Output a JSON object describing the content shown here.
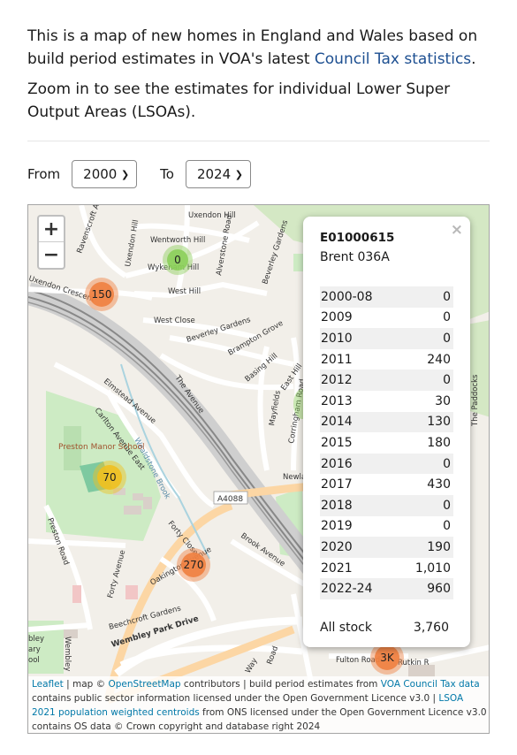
{
  "intro": {
    "p1_before": "This is a map of new homes in England and Wales based on build period estimates in VOA's latest ",
    "p1_link": "Council Tax statistics",
    "p1_after": ".",
    "p2": "Zoom in to see the estimates for individual Lower Super Output Areas (LSOAs)."
  },
  "controls": {
    "from_label": "From",
    "from_value": "2000",
    "to_label": "To",
    "to_value": "2024"
  },
  "zoom": {
    "in": "+",
    "out": "−"
  },
  "map_labels": [
    "Uxendon Hill",
    "Wentworth Hill",
    "Wykeham Hill",
    "Uxendon Hill",
    "Alverstone Road",
    "Beverley Gardens",
    "Ravenscroft Avenue",
    "Uxendon Crescent",
    "West Hill",
    "West Close",
    "Beverley Gardens",
    "Brampton Grove",
    "Basing Hill",
    "East Hill",
    "Elmstead Avenue",
    "The Avenue",
    "Carlton Avenue East",
    "Wealdstone Brook",
    "Preston Manor School",
    "Mayfields",
    "Corringham Road",
    "The Paddocks",
    "A4088",
    "Newla",
    "Preston Road",
    "Forty Close",
    "Brook Avenue",
    "Forty Avenue",
    "Oakington Avenue",
    "Beechcroft Gardens",
    "Wembley Park Drive",
    "Fulton Road",
    "Way",
    "Road",
    "bley",
    "ary",
    "ool",
    "Wembley",
    "Rutkin R"
  ],
  "clusters": [
    {
      "label": "0",
      "color": "#8ccf5a"
    },
    {
      "label": "150",
      "color": "#f08040"
    },
    {
      "label": "70",
      "color": "#f0c020"
    },
    {
      "label": "270",
      "color": "#f08040"
    },
    {
      "label": "3K",
      "color": "#f08040"
    }
  ],
  "popup": {
    "close": "×",
    "code": "E01000615",
    "name": "Brent 036A",
    "rows": [
      {
        "period": "2000-08",
        "value": "0"
      },
      {
        "period": "2009",
        "value": "0"
      },
      {
        "period": "2010",
        "value": "0"
      },
      {
        "period": "2011",
        "value": "240"
      },
      {
        "period": "2012",
        "value": "0"
      },
      {
        "period": "2013",
        "value": "30"
      },
      {
        "period": "2014",
        "value": "130"
      },
      {
        "period": "2015",
        "value": "180"
      },
      {
        "period": "2016",
        "value": "0"
      },
      {
        "period": "2017",
        "value": "430"
      },
      {
        "period": "2018",
        "value": "0"
      },
      {
        "period": "2019",
        "value": "0"
      },
      {
        "period": "2020",
        "value": "190"
      },
      {
        "period": "2021",
        "value": "1,010"
      },
      {
        "period": "2022-24",
        "value": "960"
      }
    ],
    "all_label": "All stock",
    "all_value": "3,760"
  },
  "attribution": {
    "leaflet": "Leaflet",
    "t1": " | map © ",
    "osm": "OpenStreetMap",
    "t2": " contributors | build period estimates from ",
    "voa": "VOA Council Tax data",
    "t3": " contains public sector information licensed under the Open Government Licence v3.0 | ",
    "lsoa": "LSOA 2021 population weighted centroids",
    "t4": " from ONS licensed under the Open Government Licence v3.0 contains OS data © Crown copyright and database right 2024"
  }
}
